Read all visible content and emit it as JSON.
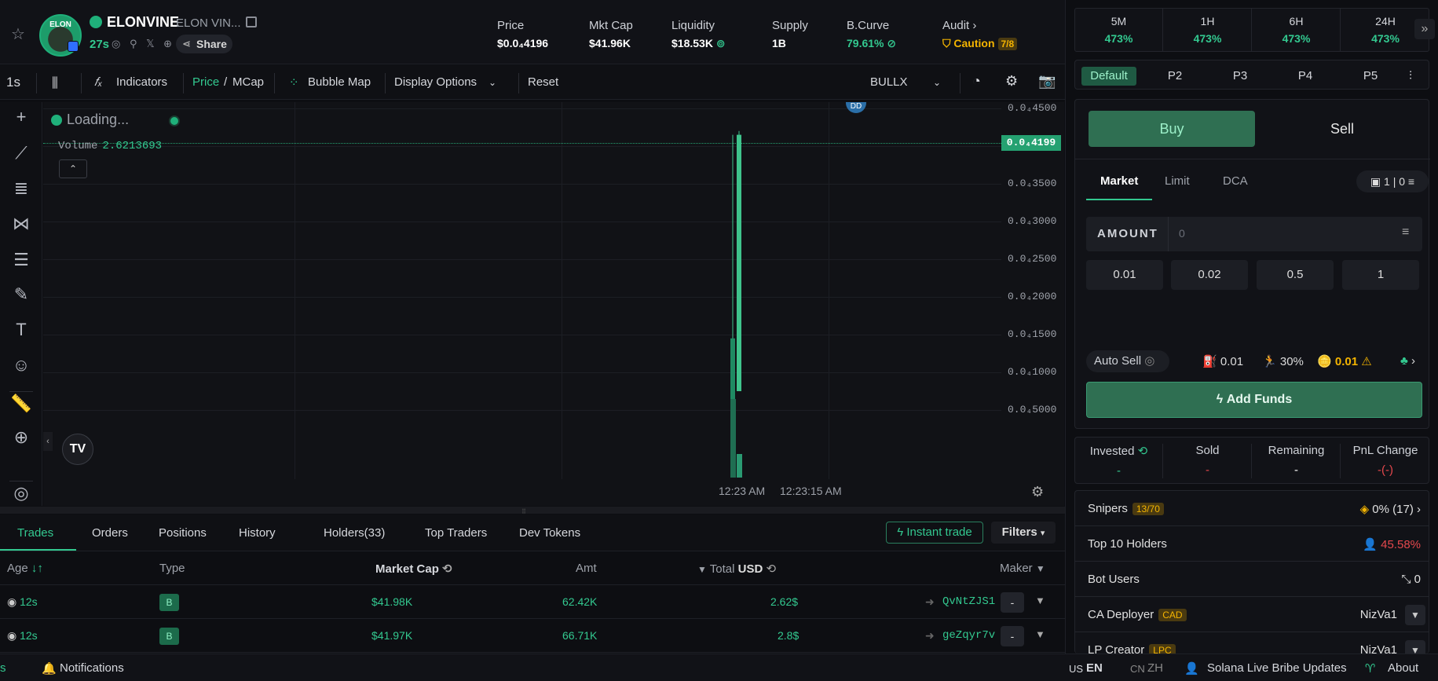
{
  "header": {
    "token_symbol": "ELONVINE",
    "token_name": "ELON VIN...",
    "avatar_text": "ELON",
    "age": "27s",
    "share_label": "Share",
    "stats": [
      {
        "label": "Price",
        "value": "$0.0₄4196"
      },
      {
        "label": "Mkt Cap",
        "value": "$41.96K"
      },
      {
        "label": "Liquidity",
        "value": "$18.53K"
      },
      {
        "label": "Supply",
        "value": "1B"
      },
      {
        "label": "B.Curve",
        "value": "79.61%"
      }
    ],
    "audit": {
      "label": "Audit",
      "status": "Caution",
      "score": "7/8"
    }
  },
  "toolbar": {
    "interval": "1s",
    "indicators": "Indicators",
    "price": "Price",
    "slash": "/",
    "mcap": "MCap",
    "bubble_map": "Bubble Map",
    "display_options": "Display Options",
    "reset": "Reset",
    "provider": "BULLX"
  },
  "chart": {
    "loading_text": "Loading...",
    "volume_label": "Volume",
    "volume_value": "2.6213693",
    "current_price_tag": "0.0₄4199",
    "dd_label": "DD",
    "tv_logo": "TV",
    "chart_data": {
      "type": "candlestick",
      "title": "",
      "y_ticks": [
        "0.0₄4500",
        "0.0₄4000",
        "0.0₄3500",
        "0.0₄3000",
        "0.0₄2500",
        "0.0₄2000",
        "0.0₄1500",
        "0.0₄1000",
        "0.0₄5000"
      ],
      "x_ticks": [
        "12:23 AM",
        "12:23:15 AM"
      ],
      "candles": [
        {
          "time": "12:23 AM",
          "open": 5e-07,
          "high": 4.15e-06,
          "low": 5e-07,
          "close": 1.45e-06
        },
        {
          "time": "12:23 AM",
          "open": 7.5e-07,
          "high": 4.2e-06,
          "low": 7.5e-07,
          "close": 4.15e-06
        }
      ]
    }
  },
  "tabs": [
    {
      "label": "Trades",
      "active": true
    },
    {
      "label": "Orders"
    },
    {
      "label": "Positions"
    },
    {
      "label": "History"
    },
    {
      "label": "Holders(33)"
    },
    {
      "label": "Top Traders"
    },
    {
      "label": "Dev Tokens"
    }
  ],
  "tab_actions": {
    "instant_trade": "Instant trade",
    "filters": "Filters"
  },
  "table": {
    "headers": {
      "age": "Age",
      "type": "Type",
      "market_cap": "Market Cap",
      "amt": "Amt",
      "total": "Total",
      "usd": "USD",
      "maker": "Maker"
    },
    "rows": [
      {
        "age": "12s",
        "type": "B",
        "market_cap": "$41.98K",
        "amt": "62.42K",
        "total": "2.62$",
        "maker": "QvNtZJS1",
        "action": "-"
      },
      {
        "age": "12s",
        "type": "B",
        "market_cap": "$41.97K",
        "amt": "66.71K",
        "total": "2.8$",
        "maker": "geZqyr7v",
        "action": "-"
      }
    ]
  },
  "status_bar": {
    "left_fragment": "s",
    "notifications": "Notifications",
    "lang_us": "US",
    "lang_en": "EN",
    "lang_cn": "CN",
    "lang_zh": "ZH",
    "solana_updates": "Solana Live Bribe Updates",
    "about": "About"
  },
  "right_panel": {
    "timeframes": [
      {
        "label": "5M",
        "value": "473%"
      },
      {
        "label": "1H",
        "value": "473%"
      },
      {
        "label": "6H",
        "value": "473%"
      },
      {
        "label": "24H",
        "value": "473%"
      }
    ],
    "presets": [
      "Default",
      "P2",
      "P3",
      "P4",
      "P5"
    ],
    "buy_label": "Buy",
    "sell_label": "Sell",
    "order_tabs": [
      "Market",
      "Limit",
      "DCA"
    ],
    "wallet_count": "1",
    "wallet_count2": "0",
    "amount_label": "AMOUNT",
    "amount_placeholder": "0",
    "quick_amounts": [
      "0.01",
      "0.02",
      "0.5",
      "1"
    ],
    "auto_sell": "Auto Sell",
    "gas": "0.01",
    "slippage": "30%",
    "priority": "0.01",
    "add_funds": "Add Funds",
    "pnl": [
      {
        "label": "Invested",
        "value": "-"
      },
      {
        "label": "Sold",
        "value": "-"
      },
      {
        "label": "Remaining",
        "value": "-"
      },
      {
        "label": "PnL Change",
        "value": "-(-)"
      }
    ],
    "info": [
      {
        "key": "Snipers",
        "tag": "13/70",
        "value": "0% (17)"
      },
      {
        "key": "Top 10 Holders",
        "value": "45.58%"
      },
      {
        "key": "Bot Users",
        "value": "0"
      },
      {
        "key": "CA Deployer",
        "tag": "CAD",
        "value": "NizVa1"
      },
      {
        "key": "LP Creator",
        "tag": "LPC",
        "value": "NizVa1"
      }
    ]
  }
}
